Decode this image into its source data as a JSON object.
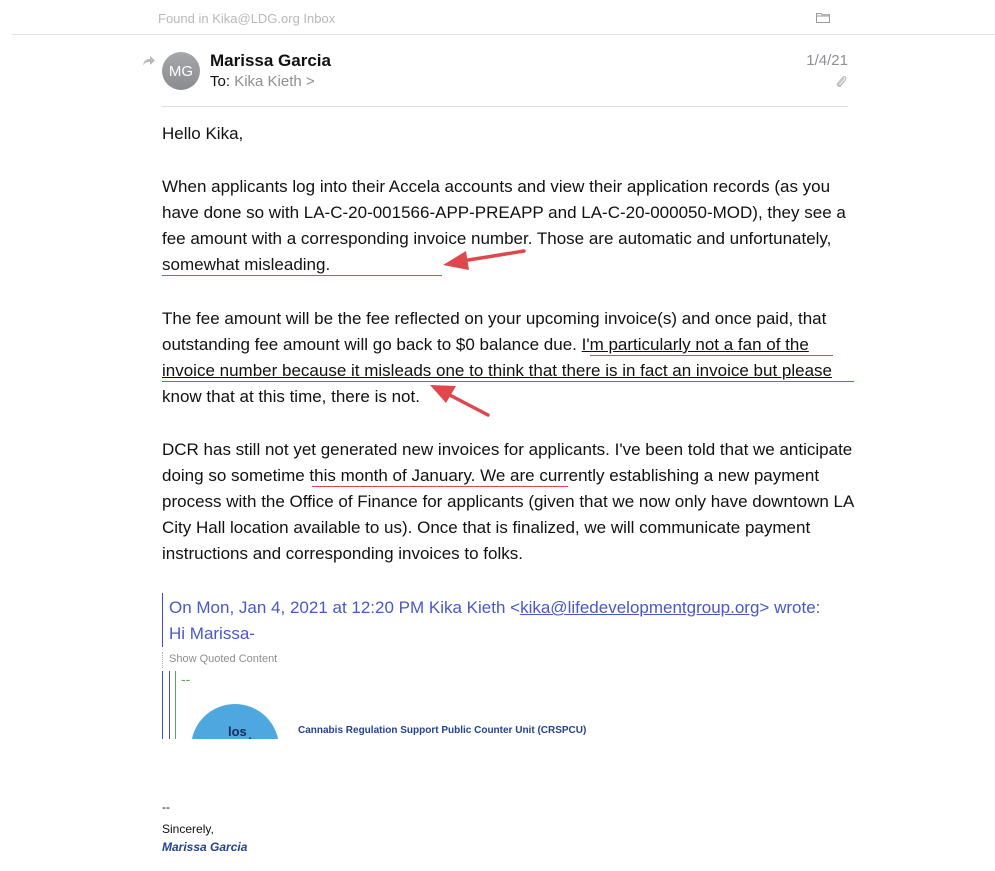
{
  "top_bar": {
    "found_in": "Found in Kika@LDG.org Inbox",
    "folder_icon": "folder-icon"
  },
  "header": {
    "avatar_initials": "MG",
    "sender_name": "Marissa Garcia",
    "to_label": "To:",
    "recipient": "Kika Kieth >",
    "date": "1/4/21",
    "reply_icon": "reply-arrow-icon",
    "attachment_icon": "paperclip-icon"
  },
  "body": {
    "greeting": "Hello Kika,",
    "p1_a": "When applicants log into their Accela accounts and view their application records (as you have done so with LA-C-20-001566-APP-PREAPP and LA-C-20-000050-MOD), they see a fee amount with a corresponding invoice number. Those are automatic and ",
    "p1_underlined": "unfortunately, somewhat misleading",
    "p1_end": ".",
    "p2_a": "The fee amount will be the fee reflected on your upcoming invoice(s) and once paid, that outstanding fee amount will go back to $0 balance due. ",
    "p2_underlined": "I'm particularly not a fan of the invoice number because it misleads one to think that there is in fact an invoice but please",
    "p2_end": " know that at this time, there is not.",
    "p3_a": "DCR has still not yet generated new invoices for applicants. I've been told that we anticipate doing so ",
    "p3_underlined": "sometime this month of January.",
    "p3_end": " We are currently establishing a new payment process with the Office of Finance for applicants (given that we now only have downtown LA City Hall location available to us). Once that is finalized, we will communicate payment instructions and corresponding invoices to folks."
  },
  "quote": {
    "line1_prefix": "On Mon, Jan 4, 2021 at 12:20 PM Kika Kieth <",
    "email_link": "kika@lifedevelopmentgroup.org",
    "line1_suffix": "> wrote:",
    "line2": "Hi Marissa-",
    "show_quoted": "Show Quoted Content",
    "dash": "--",
    "logo_text": "los",
    "logo_text2": "angeles",
    "unit_name": "Cannabis Regulation Support Public Counter Unit (CRSPCU)"
  },
  "signature": {
    "dash": "--",
    "closing": "Sincerely,",
    "name": "Marissa Garcia"
  },
  "colors": {
    "annotation_red": "#e0474c",
    "quote_blue": "#4858c8",
    "signature_blue": "#24428e"
  }
}
